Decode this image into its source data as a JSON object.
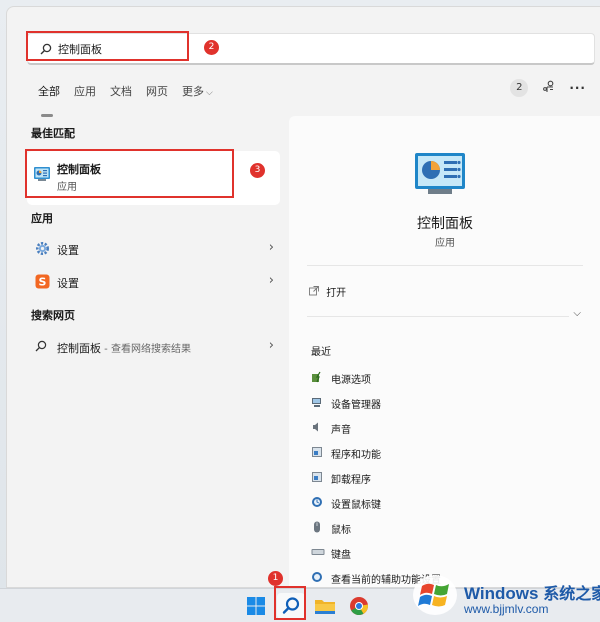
{
  "search": {
    "value": "控制面板",
    "callout_number": "2"
  },
  "tabs": [
    {
      "label": "全部",
      "active": true
    },
    {
      "label": "应用"
    },
    {
      "label": "文档"
    },
    {
      "label": "网页"
    },
    {
      "label": "更多"
    }
  ],
  "tab_bar": {
    "count": "2",
    "more_glyph": "···"
  },
  "best_match": {
    "section_title": "最佳匹配",
    "name": "控制面板",
    "type": "应用",
    "callout_number": "3"
  },
  "apps": {
    "section_title": "应用",
    "items": [
      {
        "label": "设置",
        "icon": "gear-icon"
      },
      {
        "label": "设置",
        "icon": "sogou-s-icon"
      }
    ]
  },
  "web": {
    "section_title": "搜索网页",
    "query": "控制面板",
    "suffix": " - 查看网络搜索结果"
  },
  "detail": {
    "title": "控制面板",
    "type": "应用",
    "open_label": "打开",
    "recent_title": "最近",
    "recent": [
      {
        "label": "电源选项",
        "icon": "power-options-icon"
      },
      {
        "label": "设备管理器",
        "icon": "device-manager-icon"
      },
      {
        "label": "声音",
        "icon": "speaker-icon"
      },
      {
        "label": "程序和功能",
        "icon": "programs-icon"
      },
      {
        "label": "卸载程序",
        "icon": "uninstall-icon"
      },
      {
        "label": "设置鼠标键",
        "icon": "ease-of-access-icon"
      },
      {
        "label": "鼠标",
        "icon": "mouse-icon"
      },
      {
        "label": "键盘",
        "icon": "keyboard-icon"
      },
      {
        "label": "查看当前的辅助功能设置",
        "icon": "accessibility-icon"
      }
    ]
  },
  "taskbar": {
    "callout_number": "1",
    "items": [
      "windows-start-icon",
      "search-icon",
      "file-explorer-icon",
      "chrome-icon"
    ]
  },
  "watermark": {
    "brand": "Windows",
    "brand_cn": "系统之家",
    "url": "www.bjjmlv.com"
  },
  "colors": {
    "callout_red": "#e0322c",
    "brand_blue": "#1e5aa8",
    "panel_bg": "#f3f3f3"
  }
}
